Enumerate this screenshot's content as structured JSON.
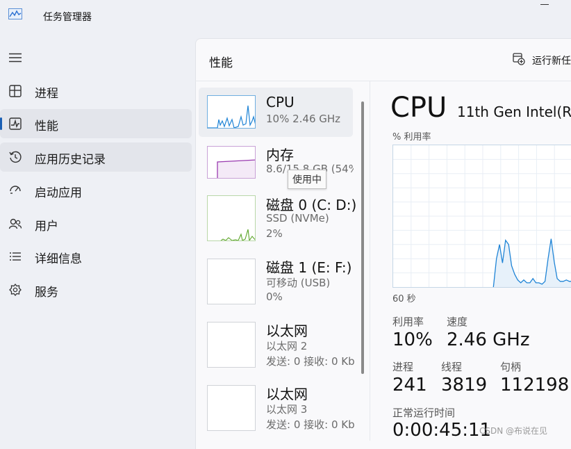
{
  "app": {
    "title": "任务管理器",
    "icon": "task-manager-icon"
  },
  "nav": {
    "items": [
      {
        "label": "进程",
        "icon": "processes-icon"
      },
      {
        "label": "性能",
        "icon": "performance-icon",
        "selected": true
      },
      {
        "label": "应用历史记录",
        "icon": "history-icon",
        "hovered": true
      },
      {
        "label": "启动应用",
        "icon": "startup-icon"
      },
      {
        "label": "用户",
        "icon": "users-icon"
      },
      {
        "label": "详细信息",
        "icon": "details-icon"
      },
      {
        "label": "服务",
        "icon": "services-icon"
      }
    ]
  },
  "header": {
    "title": "性能",
    "run_task_label": "运行新任"
  },
  "resources": [
    {
      "name": "CPU",
      "sub1": "10%  2.46 GHz",
      "selected": true
    },
    {
      "name": "内存",
      "sub1": "8.6/15.8 GB (54%"
    },
    {
      "name": "磁盘 0 (C: D:)",
      "sub1": "SSD (NVMe)",
      "sub2": "2%"
    },
    {
      "name": "磁盘 1 (E: F:)",
      "sub1": "可移动 (USB)",
      "sub2": "0%"
    },
    {
      "name": "以太网",
      "sub1": "以太网 2",
      "sub2": "发送: 0  接收: 0 Kb"
    },
    {
      "name": "以太网",
      "sub1": "以太网 3",
      "sub2": "发送: 0  接收: 0 Kb"
    }
  ],
  "tooltip": "使用中",
  "detail": {
    "title": "CPU",
    "model": "11th Gen Intel(R",
    "axis_label": "% 利用率",
    "time_label": "60 秒",
    "stats": {
      "utilization": {
        "label": "利用率",
        "value": "10%"
      },
      "speed": {
        "label": "速度",
        "value": "2.46 GHz"
      },
      "processes": {
        "label": "进程",
        "value": "241"
      },
      "threads": {
        "label": "线程",
        "value": "3819"
      },
      "handles": {
        "label": "句柄",
        "value": "112198"
      },
      "uptime": {
        "label": "正常运行时间",
        "value": "0:00:45:11"
      }
    }
  },
  "watermark": "CSDN @布说在见",
  "colors": {
    "cpu": "#1f84d6",
    "memory": "#9a3bb0",
    "disk": "#5ba528",
    "accent": "#1a5fb4"
  },
  "chart_data": {
    "type": "area",
    "values": [
      0,
      0,
      0,
      0,
      0,
      0,
      0,
      0,
      0,
      0,
      0,
      0,
      0,
      0,
      0,
      0,
      0,
      0,
      0,
      0,
      0,
      0,
      0,
      0,
      0,
      0,
      0,
      0,
      0,
      0,
      0,
      0,
      0,
      0,
      20,
      30,
      17,
      33,
      30,
      15,
      9,
      5,
      3,
      5,
      3,
      3,
      6,
      3,
      3,
      2,
      4,
      20,
      34,
      18,
      6,
      4,
      4,
      5,
      4,
      4
    ],
    "ylim": [
      0,
      100
    ]
  }
}
